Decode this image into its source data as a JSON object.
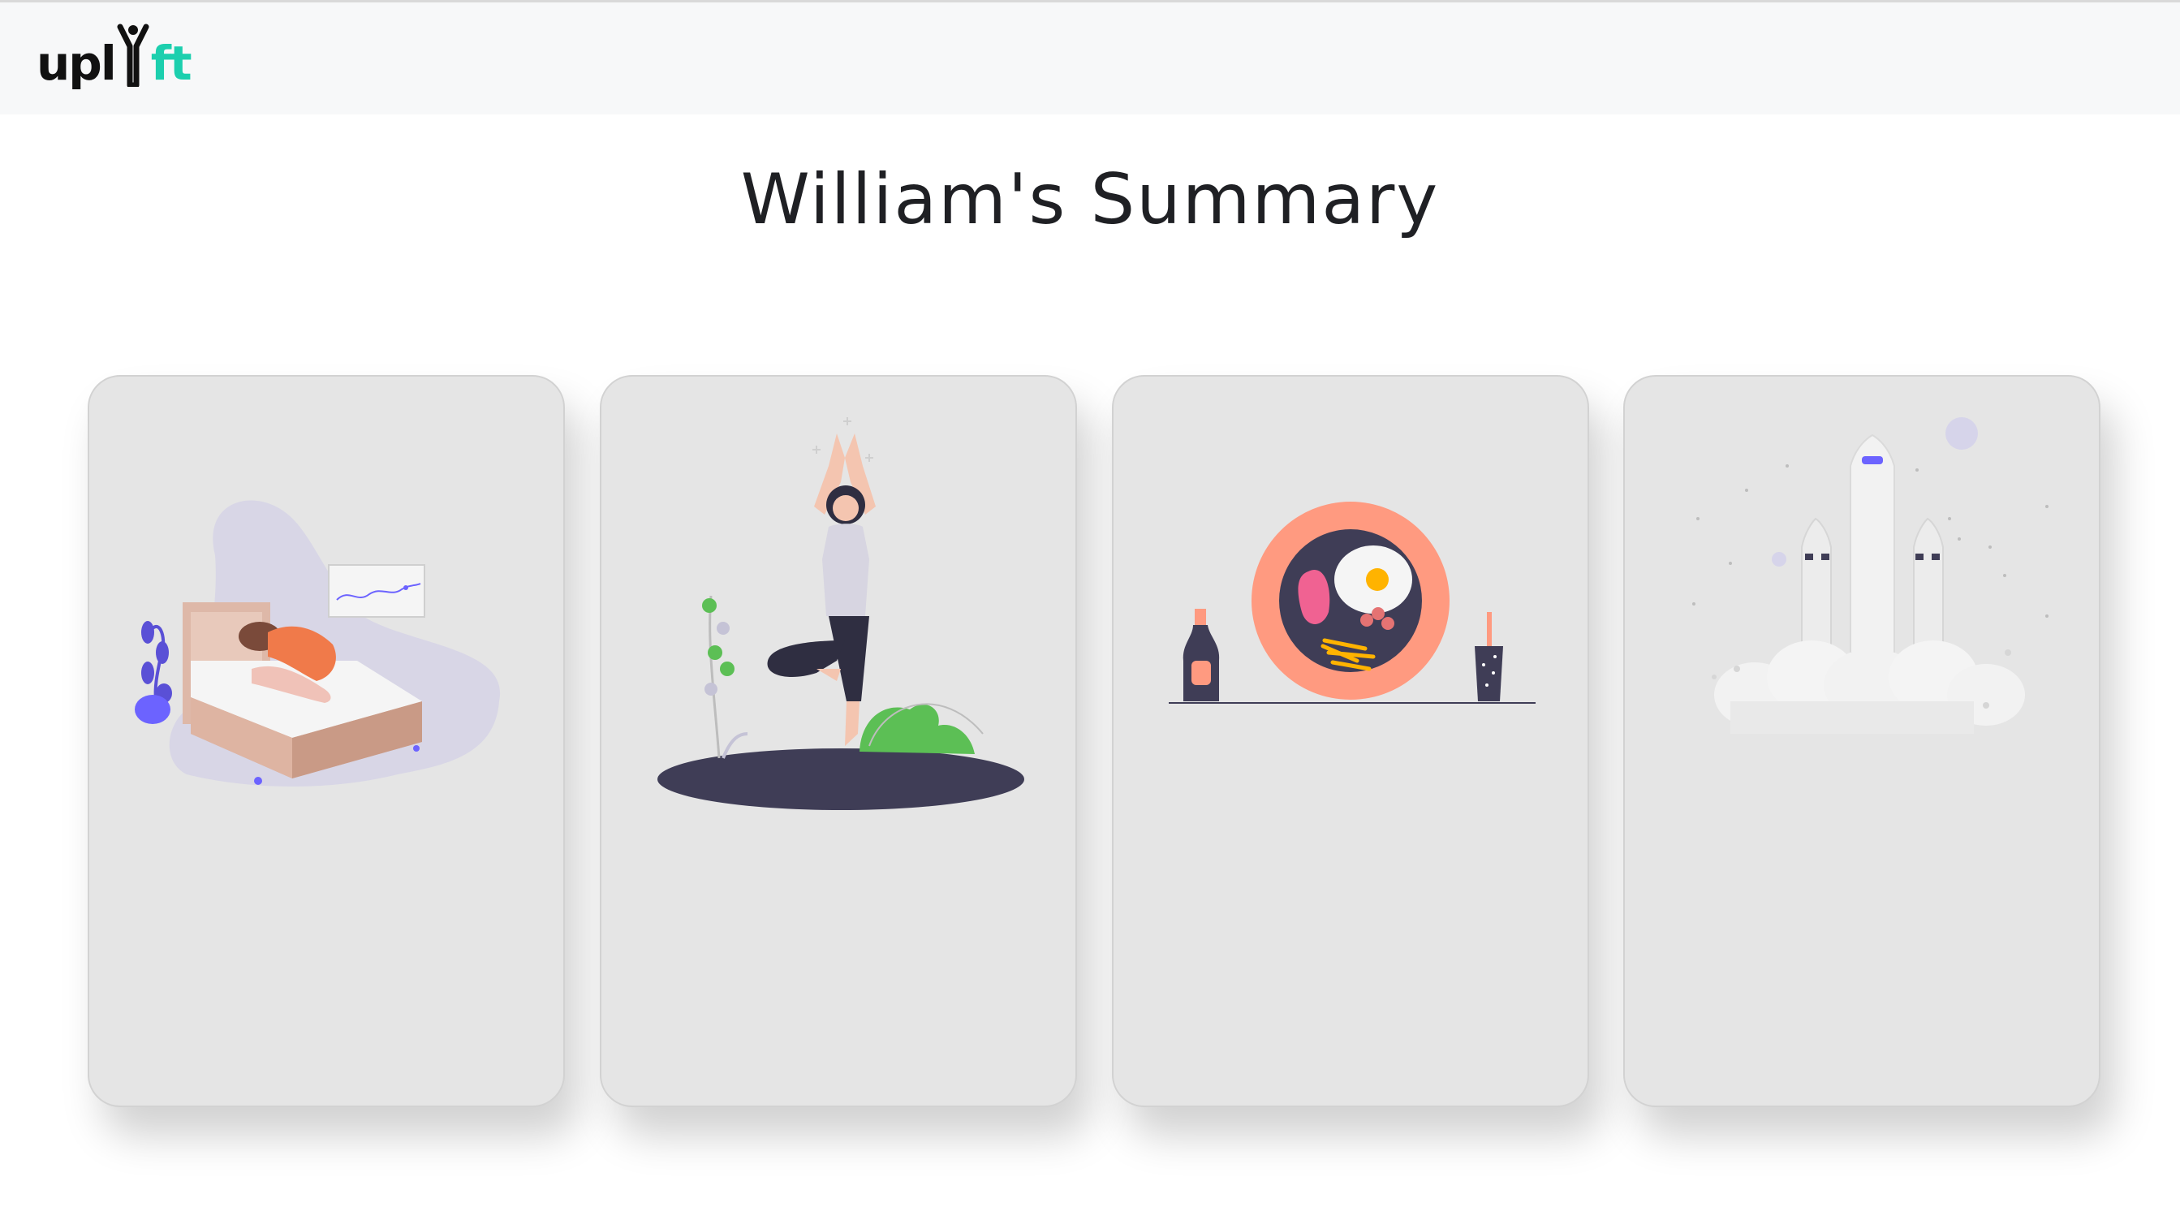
{
  "header": {
    "logo": {
      "part1": "up",
      "part2": "l",
      "part3": "ft"
    }
  },
  "page": {
    "title": "William's Summary"
  },
  "cards": [
    {
      "illustration": "sleep-illustration"
    },
    {
      "illustration": "yoga-illustration"
    },
    {
      "illustration": "food-illustration"
    },
    {
      "illustration": "rocket-illustration"
    }
  ],
  "colors": {
    "accent_teal": "#1ccfae",
    "card_bg": "#e5e5e5",
    "purple": "#6c63ff",
    "coral": "#ff9a80",
    "dark": "#3f3d56"
  }
}
